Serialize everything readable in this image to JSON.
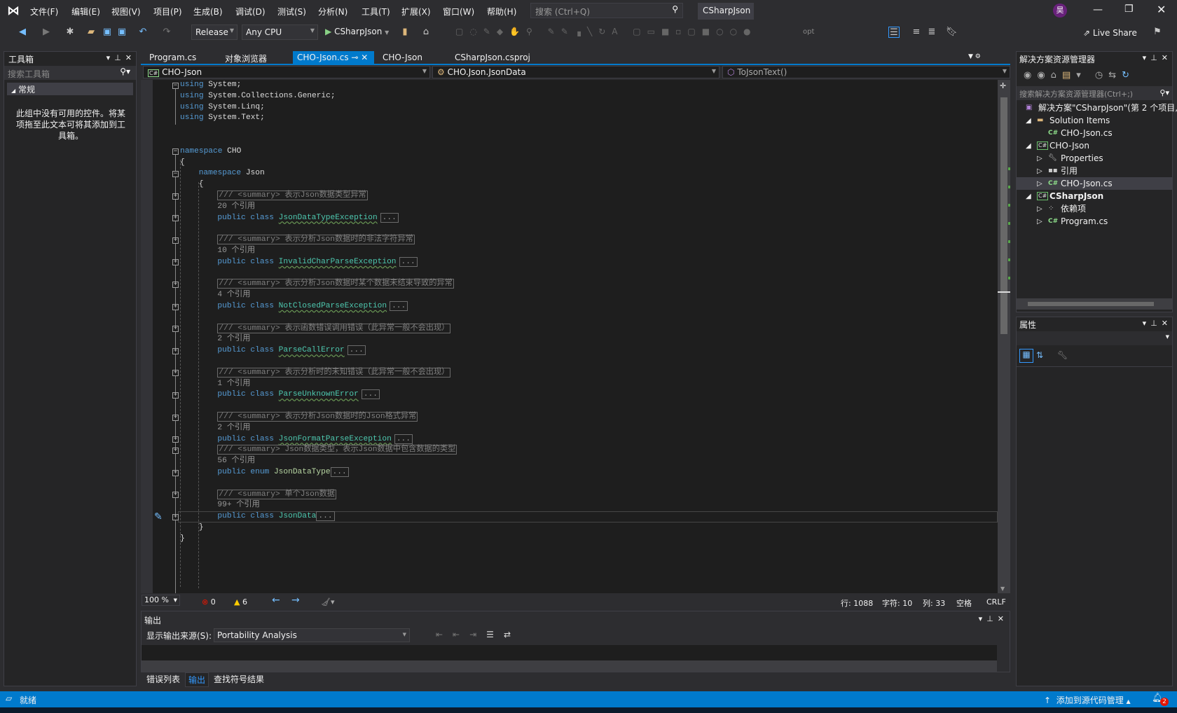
{
  "titlebar": {
    "menu": [
      "文件(F)",
      "编辑(E)",
      "视图(V)",
      "项目(P)",
      "生成(B)",
      "调试(D)",
      "测试(S)",
      "分析(N)",
      "工具(T)",
      "扩展(X)",
      "窗口(W)",
      "帮助(H)"
    ],
    "search_placeholder": "搜索 (Ctrl+Q)",
    "solution_name": "CSharpJson",
    "avatar": "昊"
  },
  "toolbar": {
    "configuration": "Release",
    "platform": "Any CPU",
    "start_target": "CSharpJson",
    "live_share": "Live Share",
    "opt": "opt"
  },
  "toolbox": {
    "title": "工具箱",
    "search_placeholder": "搜索工具箱",
    "group": "常规",
    "empty_message": "此组中没有可用的控件。将某项拖至此文本可将其添加到工具箱。"
  },
  "tabs": [
    {
      "label": "Program.cs"
    },
    {
      "label": "对象浏览器"
    },
    {
      "label": "CHO-Json.cs",
      "active": true
    },
    {
      "label": "CHO-Json"
    },
    {
      "label": "CSharpJson.csproj"
    }
  ],
  "navbar": {
    "project": "CHO-Json",
    "type": "CHO.Json.JsonData",
    "member": "ToJsonText()"
  },
  "code": {
    "lines": [
      {
        "i": 0,
        "f": "-",
        "t": [
          [
            "kw",
            "using"
          ],
          [
            "tx",
            " System;"
          ]
        ]
      },
      {
        "i": 0,
        "t": [
          [
            "kw",
            "using"
          ],
          [
            "tx",
            " System.Collections.Generic;"
          ]
        ]
      },
      {
        "i": 0,
        "t": [
          [
            "kw",
            "using"
          ],
          [
            "tx",
            " System.Linq;"
          ]
        ]
      },
      {
        "i": 0,
        "t": [
          [
            "kw",
            "using"
          ],
          [
            "tx",
            " System.Text;"
          ]
        ]
      },
      {
        "i": 0,
        "t": []
      },
      {
        "i": 0,
        "t": []
      },
      {
        "i": 0,
        "f": "-",
        "t": [
          [
            "kw",
            "namespace"
          ],
          [
            "tx",
            " CHO"
          ]
        ]
      },
      {
        "i": 0,
        "t": [
          [
            "tx",
            "{"
          ]
        ]
      },
      {
        "i": 1,
        "f": "-",
        "t": [
          [
            "kw",
            "namespace"
          ],
          [
            "tx",
            " Json"
          ]
        ]
      },
      {
        "i": 1,
        "t": [
          [
            "tx",
            "{"
          ]
        ]
      },
      {
        "i": 2,
        "f": "+",
        "t": [
          [
            "cm",
            "/// <summary> 表示Json数据类型异常"
          ]
        ]
      },
      {
        "i": 2,
        "t": [
          [
            "lens",
            "20 个引用"
          ]
        ]
      },
      {
        "i": 2,
        "f": "+",
        "t": [
          [
            "kw",
            "public class "
          ],
          [
            "tysq",
            "JsonDataTypeException"
          ],
          [
            "ell",
            "..."
          ]
        ]
      },
      {
        "i": 0,
        "t": []
      },
      {
        "i": 2,
        "f": "+",
        "t": [
          [
            "cm",
            "/// <summary> 表示分析Json数据时的非法字符异常"
          ]
        ]
      },
      {
        "i": 2,
        "t": [
          [
            "lens",
            "10 个引用"
          ]
        ]
      },
      {
        "i": 2,
        "f": "+",
        "t": [
          [
            "kw",
            "public class "
          ],
          [
            "tysq",
            "InvalidCharParseException"
          ],
          [
            "ell",
            "..."
          ]
        ]
      },
      {
        "i": 0,
        "t": []
      },
      {
        "i": 2,
        "f": "+",
        "t": [
          [
            "cm",
            "/// <summary> 表示分析Json数据时某个数据未结束导致的异常"
          ]
        ]
      },
      {
        "i": 2,
        "t": [
          [
            "lens",
            "4 个引用"
          ]
        ]
      },
      {
        "i": 2,
        "f": "+",
        "t": [
          [
            "kw",
            "public class "
          ],
          [
            "tysq",
            "NotClosedParseException"
          ],
          [
            "ell",
            "..."
          ]
        ]
      },
      {
        "i": 0,
        "t": []
      },
      {
        "i": 2,
        "f": "+",
        "t": [
          [
            "cm",
            "/// <summary> 表示函数错误调用错误（此异常一般不会出现）"
          ]
        ]
      },
      {
        "i": 2,
        "t": [
          [
            "lens",
            "2 个引用"
          ]
        ]
      },
      {
        "i": 2,
        "f": "+",
        "t": [
          [
            "kw",
            "public class "
          ],
          [
            "tysq",
            "ParseCallError"
          ],
          [
            "ell",
            "..."
          ]
        ]
      },
      {
        "i": 0,
        "t": []
      },
      {
        "i": 2,
        "f": "+",
        "t": [
          [
            "cm",
            "/// <summary> 表示分析时的未知错误（此异常一般不会出现）"
          ]
        ]
      },
      {
        "i": 2,
        "t": [
          [
            "lens",
            "1 个引用"
          ]
        ]
      },
      {
        "i": 2,
        "f": "+",
        "t": [
          [
            "kw",
            "public class "
          ],
          [
            "tysq",
            "ParseUnknownError"
          ],
          [
            "ell",
            "..."
          ]
        ]
      },
      {
        "i": 0,
        "t": []
      },
      {
        "i": 2,
        "f": "+",
        "t": [
          [
            "cm",
            "/// <summary> 表示分析Json数据时的Json格式异常"
          ]
        ]
      },
      {
        "i": 2,
        "t": [
          [
            "lens",
            "2 个引用"
          ]
        ]
      },
      {
        "i": 2,
        "f": "+",
        "t": [
          [
            "kw",
            "public class "
          ],
          [
            "tysq",
            "JsonFormatParseException"
          ],
          [
            "ell",
            "..."
          ]
        ]
      },
      {
        "i": 2,
        "f": "+",
        "t": [
          [
            "cm",
            "/// <summary> Json数据类型，表示Json数据中包含数据的类型"
          ]
        ]
      },
      {
        "i": 2,
        "t": [
          [
            "lens",
            "56 个引用"
          ]
        ]
      },
      {
        "i": 2,
        "f": "+",
        "t": [
          [
            "kw",
            "public enum "
          ],
          [
            "en",
            "JsonDataType"
          ],
          [
            "ellt",
            "..."
          ]
        ]
      },
      {
        "i": 0,
        "t": []
      },
      {
        "i": 2,
        "f": "+",
        "t": [
          [
            "cm",
            "/// <summary> 单个Json数据"
          ]
        ]
      },
      {
        "i": 2,
        "t": [
          [
            "lens",
            "99+ 个引用"
          ]
        ]
      },
      {
        "i": 2,
        "f": "+",
        "cur": true,
        "t": [
          [
            "kw",
            "public class "
          ],
          [
            "ty",
            "JsonData"
          ],
          [
            "ellt",
            "..."
          ]
        ]
      },
      {
        "i": 1,
        "t": [
          [
            "tx",
            "}"
          ]
        ]
      },
      {
        "i": 0,
        "t": [
          [
            "tx",
            "}"
          ]
        ]
      }
    ]
  },
  "editor_status": {
    "zoom": "100 %",
    "errors": "0",
    "warnings": "6",
    "line": "行: 1088",
    "char": "字符: 10",
    "col": "列: 33",
    "whitespace": "空格",
    "eol": "CRLF"
  },
  "output": {
    "title": "输出",
    "source_label": "显示输出来源(S):",
    "source_value": "Portability Analysis"
  },
  "bottom_tabs": [
    {
      "label": "错误列表"
    },
    {
      "label": "输出",
      "active": true
    },
    {
      "label": "查找符号结果"
    }
  ],
  "solution_explorer": {
    "title": "解决方案资源管理器",
    "search_placeholder": "搜索解决方案资源管理器(Ctrl+;)",
    "items": [
      {
        "label": "解决方案\"CSharpJson\"(第 2 个项目,",
        "icon": "solution-icon",
        "depth": 0
      },
      {
        "label": "Solution Items",
        "icon": "folder-icon",
        "depth": 1,
        "expanded": true
      },
      {
        "label": "CHO-Json.cs",
        "icon": "csharp-file-icon",
        "depth": 2
      },
      {
        "label": "CHO-Json",
        "icon": "csharp-project-icon",
        "depth": 1,
        "expanded": true
      },
      {
        "label": "Properties",
        "icon": "wrench-icon",
        "depth": 2,
        "collapsed": true
      },
      {
        "label": "引用",
        "icon": "references-icon",
        "depth": 2,
        "collapsed": true
      },
      {
        "label": "CHO-Json.cs",
        "icon": "csharp-file-icon",
        "depth": 2,
        "collapsed": true,
        "selected": true
      },
      {
        "label": "CSharpJson",
        "icon": "csharp-project-icon",
        "depth": 1,
        "expanded": true,
        "bold": true
      },
      {
        "label": "依赖项",
        "icon": "dependencies-icon",
        "depth": 2,
        "collapsed": true
      },
      {
        "label": "Program.cs",
        "icon": "csharp-file-icon",
        "depth": 2,
        "collapsed": true
      }
    ]
  },
  "properties": {
    "title": "属性"
  },
  "statusbar": {
    "ready": "就绪",
    "source_control": "添加到源代码管理",
    "notifications": "2"
  },
  "colors": {
    "accent": "#007acc",
    "editor_bg": "#1e1e1e",
    "keyword": "#569cd6",
    "type": "#4ec9b0"
  }
}
